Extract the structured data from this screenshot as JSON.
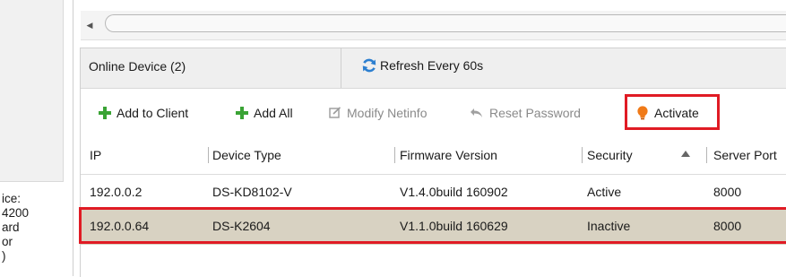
{
  "left_panel": {
    "lines": [
      "ice:",
      "4200",
      "ard",
      "or",
      ")"
    ]
  },
  "header": {
    "online_title": "Online Device (2)",
    "refresh_label": "Refresh Every 60s"
  },
  "toolbar": {
    "add_to_client": "Add to Client",
    "add_all": "Add All",
    "modify_netinfo": "Modify Netinfo",
    "reset_password": "Reset Password",
    "activate": "Activate"
  },
  "table": {
    "columns": [
      "IP",
      "Device Type",
      "Firmware Version",
      "Security",
      "Server Port"
    ],
    "rows": [
      [
        "192.0.0.2",
        "DS-KD8102-V",
        "V1.4.0build 160902",
        "Active",
        "8000"
      ],
      [
        "192.0.0.64",
        "DS-K2604",
        "V1.1.0build 160629",
        "Inactive",
        "8000"
      ]
    ]
  },
  "colors": {
    "highlight": "#e01b24",
    "plus_green": "#3aa335",
    "activate_orange": "#f07a18",
    "refresh_blue": "#2c7fd0"
  }
}
